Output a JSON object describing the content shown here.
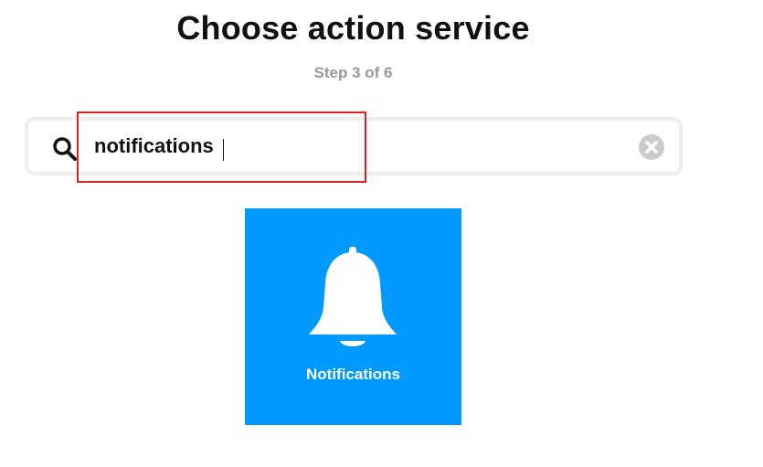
{
  "header": {
    "title": "Choose action service",
    "step": "Step 3 of 6"
  },
  "search": {
    "value": "notifications",
    "icon": "search-icon",
    "clear_icon": "clear-icon"
  },
  "results": [
    {
      "label": "Notifications",
      "icon": "bell-icon",
      "color": "#0099ff"
    }
  ],
  "colors": {
    "accent": "#0099ff",
    "highlight": "#e01f1f",
    "muted": "#999999"
  }
}
